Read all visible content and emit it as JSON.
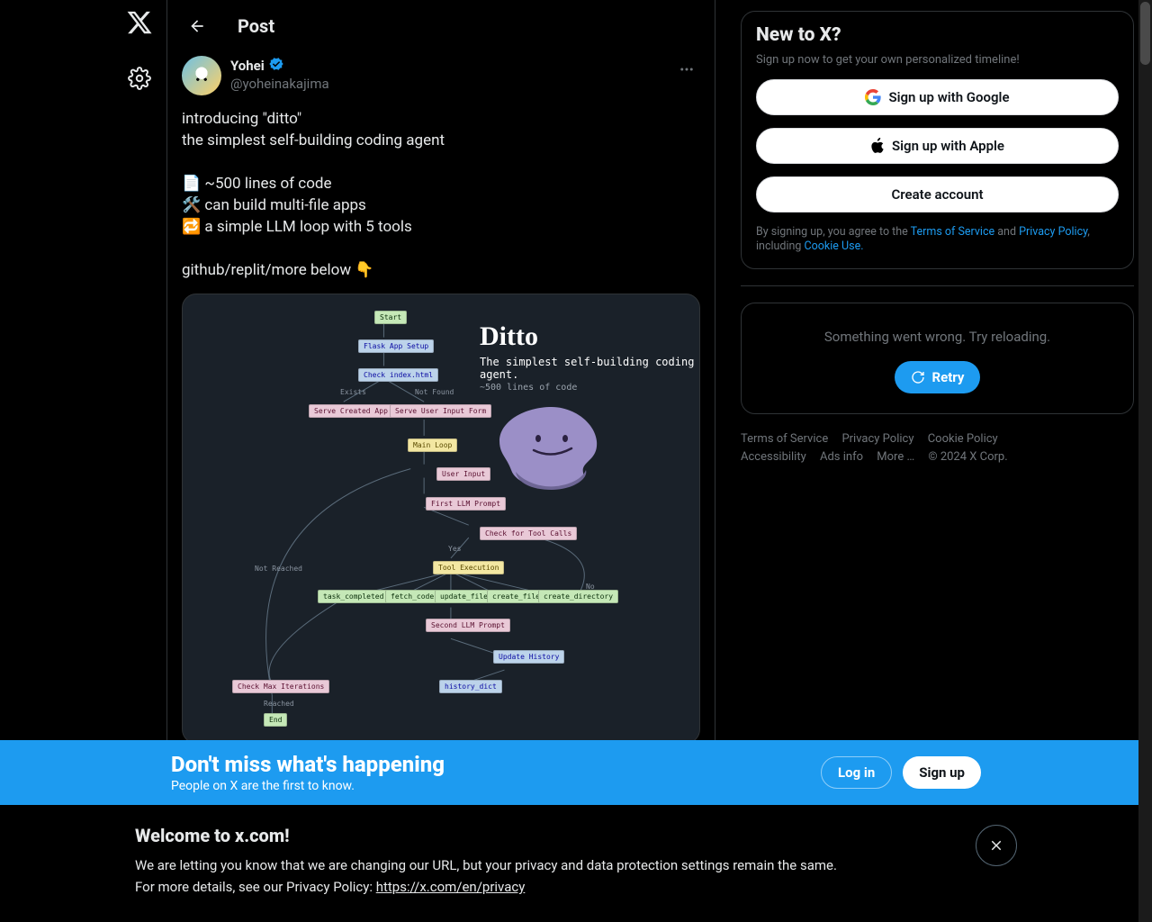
{
  "header": {
    "page_title": "Post"
  },
  "post": {
    "author": {
      "name": "Yohei",
      "handle": "@yoheinakajima"
    },
    "lines": [
      "introducing \"ditto\"",
      "the simplest self-building coding agent",
      "",
      "📄 ~500 lines of code",
      "🛠️ can build multi-file apps",
      "🔁 a simple LLM loop with 5 tools",
      "",
      "github/replit/more below 👇"
    ],
    "media": {
      "title": "Ditto",
      "subtitle": "The simplest self-building coding agent.",
      "subtitle2": "~500 lines of code",
      "nodes": {
        "start": "Start",
        "flask": "Flask App Setup",
        "check_index": "Check index.html",
        "exists": "Exists",
        "not_found": "Not Found",
        "serve_created": "Serve Created App",
        "serve_form": "Serve User Input Form",
        "main_loop": "Main Loop",
        "user_input": "User Input",
        "first_prompt": "First LLM Prompt",
        "check_tools": "Check for Tool Calls",
        "yes": "Yes",
        "no": "No",
        "tool_exec": "Tool Execution",
        "task_completed": "task_completed",
        "fetch_code": "fetch_code",
        "update_file": "update_file",
        "create_file": "create_file",
        "create_directory": "create_directory",
        "second_prompt": "Second LLM Prompt",
        "update_history": "Update History",
        "history_dict": "history_dict",
        "check_max": "Check Max Iterations",
        "not_reached": "Not Reached",
        "reached": "Reached",
        "end": "End"
      }
    }
  },
  "signup": {
    "title": "New to X?",
    "blurb": "Sign up now to get your own personalized timeline!",
    "google": "Sign up with Google",
    "apple": "Sign up with Apple",
    "create": "Create account",
    "legal_prefix": "By signing up, you agree to the ",
    "tos": "Terms of Service",
    "and": " and ",
    "privacy": "Privacy Policy",
    "including": ", including ",
    "cookie": "Cookie Use."
  },
  "error": {
    "msg": "Something went wrong. Try reloading.",
    "retry": "Retry"
  },
  "footer": {
    "tos": "Terms of Service",
    "privacy": "Privacy Policy",
    "cookie": "Cookie Policy",
    "accessibility": "Accessibility",
    "ads": "Ads info",
    "more": "More",
    "corp": "© 2024 X Corp."
  },
  "banner": {
    "title": "Don't miss what's happening",
    "sub": "People on X are the first to know.",
    "login": "Log in",
    "signup": "Sign up"
  },
  "notice": {
    "title": "Welcome to x.com!",
    "line1": "We are letting you know that we are changing our URL, but your privacy and data protection settings remain the same.",
    "line2_prefix": "For more details, see our Privacy Policy: ",
    "link": "https://x.com/en/privacy"
  }
}
